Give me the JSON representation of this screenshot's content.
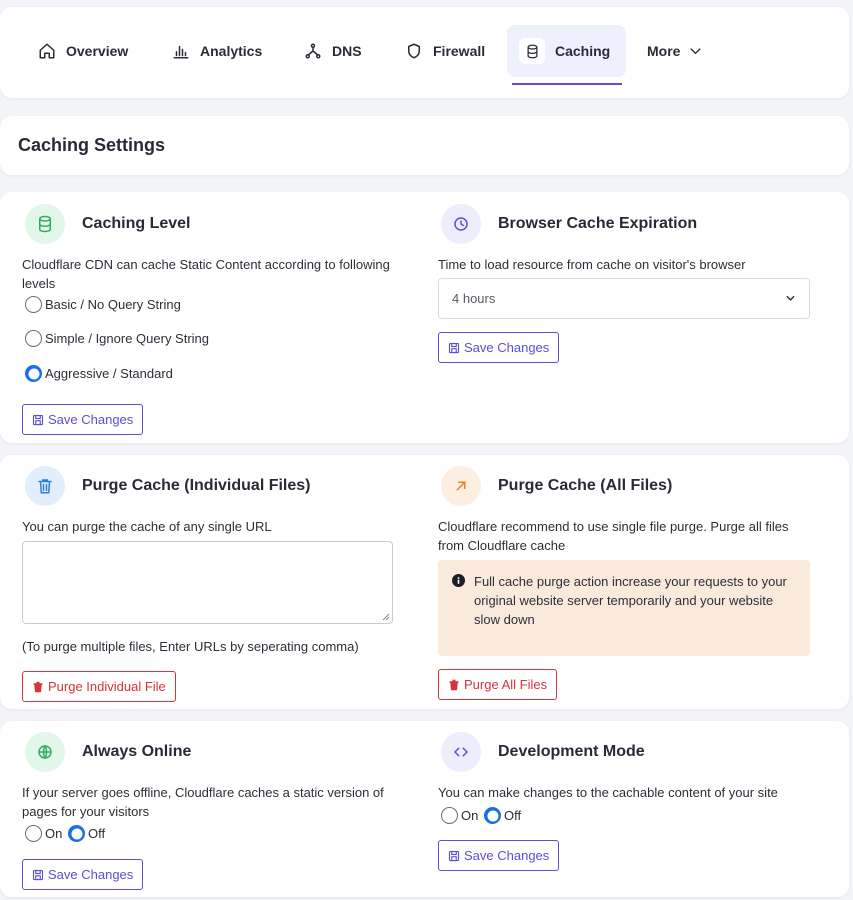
{
  "nav": {
    "tabs": [
      {
        "label": "Overview",
        "icon": "home-icon"
      },
      {
        "label": "Analytics",
        "icon": "bar-chart-icon"
      },
      {
        "label": "DNS",
        "icon": "network-icon"
      },
      {
        "label": "Firewall",
        "icon": "shield-icon"
      },
      {
        "label": "Caching",
        "icon": "database-icon"
      },
      {
        "label": "More",
        "icon": "chevron-down-icon"
      }
    ],
    "active": "Caching"
  },
  "page_title": "Caching Settings",
  "colors": {
    "accent": "#5b4fd6",
    "danger": "#d6343a",
    "radio": "#1a6fe8",
    "note_bg": "#f9eadc"
  },
  "caching_level": {
    "title": "Caching Level",
    "description": "Cloudflare CDN can cache Static Content according to following levels",
    "options": [
      "Basic / No Query String",
      "Simple / Ignore Query String",
      "Aggressive / Standard"
    ],
    "selected": "Aggressive / Standard",
    "save_label": "Save Changes"
  },
  "browser_cache": {
    "title": "Browser Cache Expiration",
    "description": "Time to load resource from cache on visitor's browser",
    "selected_value": "4 hours",
    "save_label": "Save Changes"
  },
  "purge_individual": {
    "title": "Purge Cache (Individual Files)",
    "description": "You can purge the cache of any single URL",
    "textarea_value": "",
    "hint": "(To purge multiple files, Enter URLs by seperating comma)",
    "button_label": "Purge Individual File"
  },
  "purge_all": {
    "title": "Purge Cache (All Files)",
    "description": "Cloudflare recommend to use single file purge. Purge all files from Cloudflare cache",
    "warning": "Full cache purge action increase your requests to your original website server temporarily and your website slow down",
    "button_label": "Purge All Files"
  },
  "always_online": {
    "title": "Always Online",
    "description": "If your server goes offline, Cloudflare caches a static version of pages for your visitors",
    "on_label": "On",
    "off_label": "Off",
    "selected": "Off",
    "save_label": "Save Changes"
  },
  "dev_mode": {
    "title": "Development Mode",
    "description": "You can make changes to the cachable content of your site",
    "on_label": "On",
    "off_label": "Off",
    "selected": "Off",
    "save_label": "Save Changes"
  }
}
